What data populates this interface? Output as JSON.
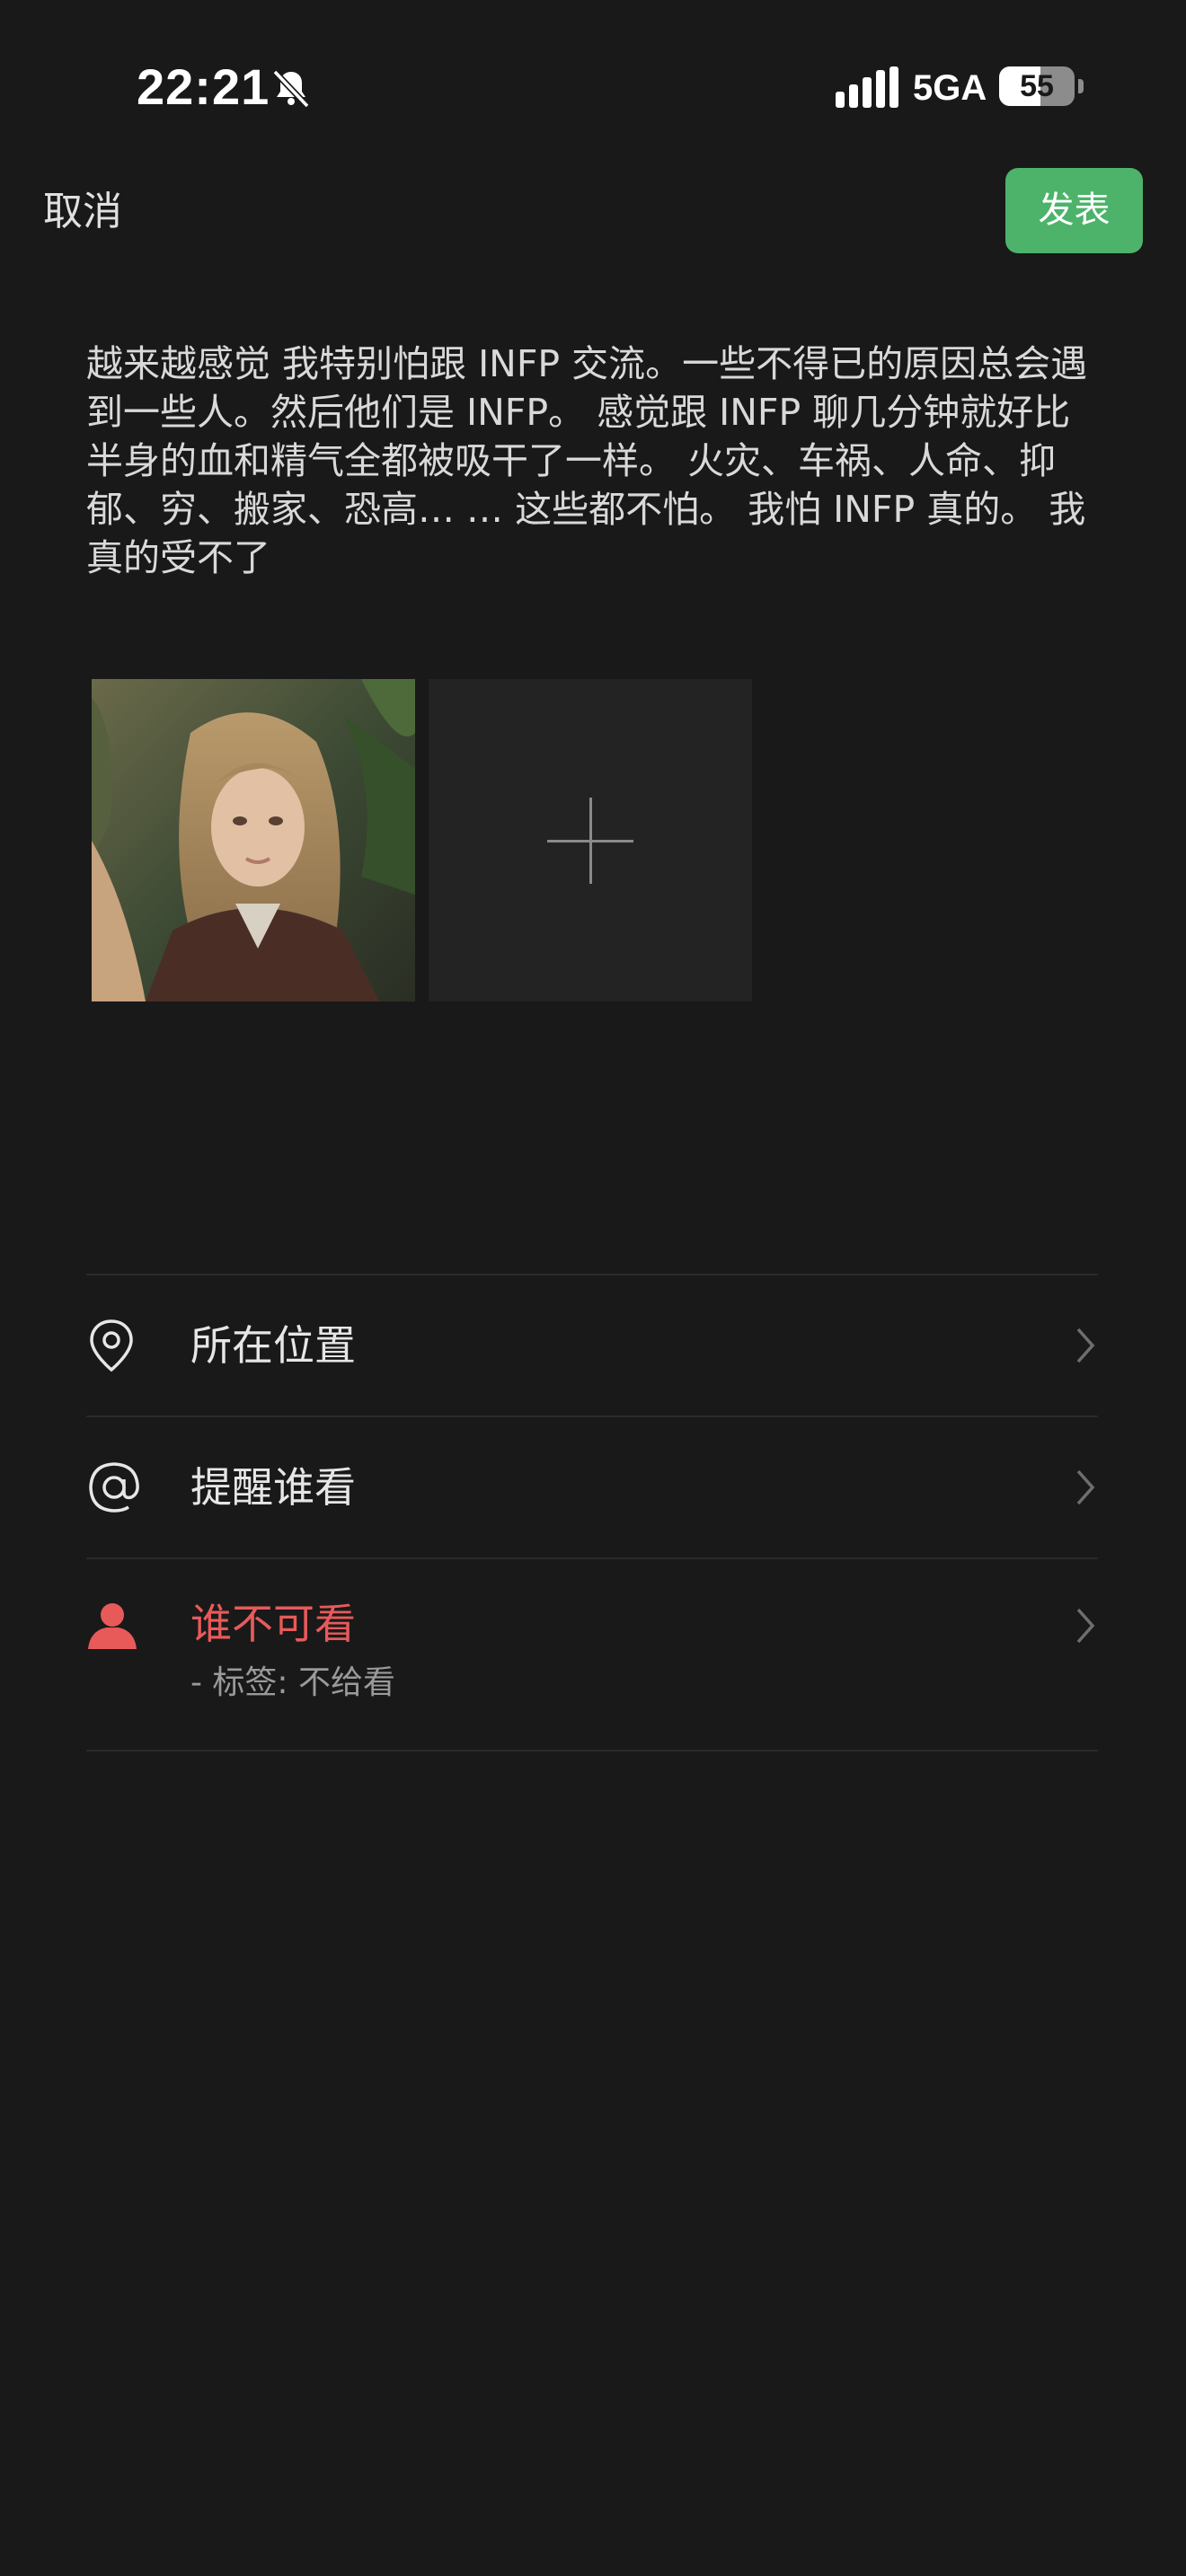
{
  "status_bar": {
    "time": "22:21",
    "network": "5GA",
    "battery": "55",
    "battery_level_percent": 55,
    "icons": [
      "bell-muted-icon",
      "signal-icon",
      "battery-icon"
    ]
  },
  "top_bar": {
    "cancel_label": "取消",
    "publish_label": "发表",
    "publish_color": "#4db36a"
  },
  "post": {
    "text": "越来越感觉 我特别怕跟 INFP 交流。一些不得已的原因总会遇到一些人。然后他们是 INFP。 感觉跟 INFP 聊几分钟就好比半身的血和精气全都被吸干了一样。  火灾、车祸、人命、抑郁、穷、搬家、恐高… … 这些都不怕。 我怕 INFP 真的。 我真的受不了"
  },
  "media": {
    "photo_count": 1,
    "add_icon": "plus-icon"
  },
  "options": {
    "location": {
      "label": "所在位置",
      "icon": "location-pin-icon"
    },
    "mention": {
      "label": "提醒谁看",
      "icon": "at-icon"
    },
    "privacy": {
      "label": "谁不可看",
      "sub": "- 标签: 不给看",
      "icon": "person-icon",
      "color": "#e85a5a"
    },
    "chevron_icon": "chevron-right-icon"
  }
}
